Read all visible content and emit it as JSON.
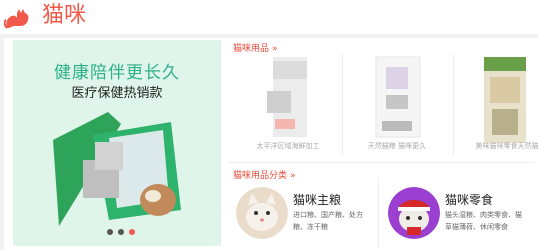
{
  "header": {
    "title": "猫咪"
  },
  "banner": {
    "headline": "健康陪伴更长久",
    "subline": "医疗保健热销款",
    "dots": 3,
    "active_dot": 3
  },
  "products_section": {
    "label": "猫咪用品",
    "arrow": "»",
    "items": [
      {
        "name": "太平洋区域海鲜加工"
      },
      {
        "name": "天然猫粮 猫咪更久"
      },
      {
        "name": "美味猫咪零食天然猫"
      }
    ]
  },
  "categories_section": {
    "label": "猫咪用品分类",
    "arrow": "»",
    "items": [
      {
        "title": "猫咪主粮",
        "desc_line1": "进口粮、国产粮、处方",
        "desc_line2": "粮、冻干粮"
      },
      {
        "title": "猫咪零食",
        "desc_line1": "猫头湿粮、肉类零食、猫",
        "desc_line2": "草猫薄荷、休闲零食"
      }
    ]
  },
  "colors": {
    "accent": "#f15a4a",
    "banner_bg": "#dff5ea",
    "banner_text": "#2bb08a"
  }
}
